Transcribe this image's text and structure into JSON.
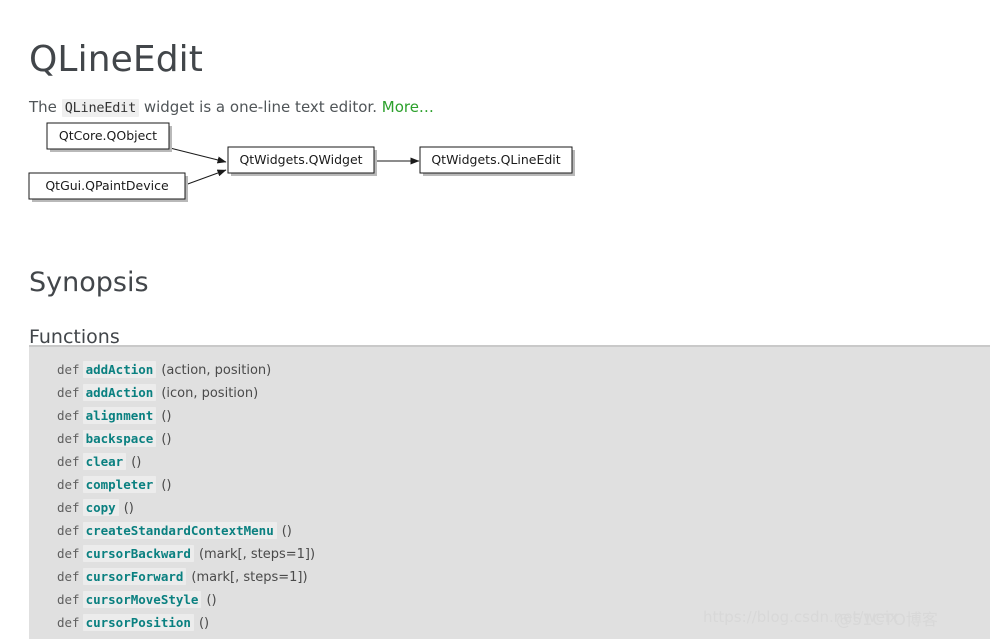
{
  "page": {
    "title": "QLineEdit"
  },
  "intro": {
    "before": "The",
    "code": "QLineEdit",
    "after": "widget is a one-line text editor.",
    "more_link": "More…"
  },
  "diagram": {
    "name": "inheritance-diagram",
    "boxes": [
      {
        "id": "qobject",
        "label": "QtCore.QObject"
      },
      {
        "id": "qpaintdevice",
        "label": "QtGui.QPaintDevice"
      },
      {
        "id": "qwidget",
        "label": "QtWidgets.QWidget"
      },
      {
        "id": "qlineedit",
        "label": "QtWidgets.QLineEdit"
      }
    ],
    "edges": [
      {
        "from": "qobject",
        "to": "qwidget"
      },
      {
        "from": "qpaintdevice",
        "to": "qwidget"
      },
      {
        "from": "qwidget",
        "to": "qlineedit"
      }
    ]
  },
  "headings": {
    "synopsis": "Synopsis",
    "functions": "Functions"
  },
  "functions": {
    "keyword": "def",
    "items": [
      {
        "name": "addAction",
        "args": "(action, position)"
      },
      {
        "name": "addAction",
        "args": "(icon, position)"
      },
      {
        "name": "alignment",
        "args": "()"
      },
      {
        "name": "backspace",
        "args": "()"
      },
      {
        "name": "clear",
        "args": "()"
      },
      {
        "name": "completer",
        "args": "()"
      },
      {
        "name": "copy",
        "args": "()"
      },
      {
        "name": "createStandardContextMenu",
        "args": "()"
      },
      {
        "name": "cursorBackward",
        "args": "(mark[, steps=1])"
      },
      {
        "name": "cursorForward",
        "args": "(mark[, steps=1])"
      },
      {
        "name": "cursorMoveStyle",
        "args": "()"
      },
      {
        "name": "cursorPosition",
        "args": "()"
      }
    ]
  },
  "watermarks": {
    "csdn": "https://blog.csdn.net/weix",
    "cto": "@51CTO博客"
  },
  "colors": {
    "heading": "#42464a",
    "body_text": "#505558",
    "link_green": "#2ca02c",
    "fn_teal": "#0a8080",
    "block_bg": "#e0e0e0",
    "inline_code_bg": "#efefef"
  }
}
